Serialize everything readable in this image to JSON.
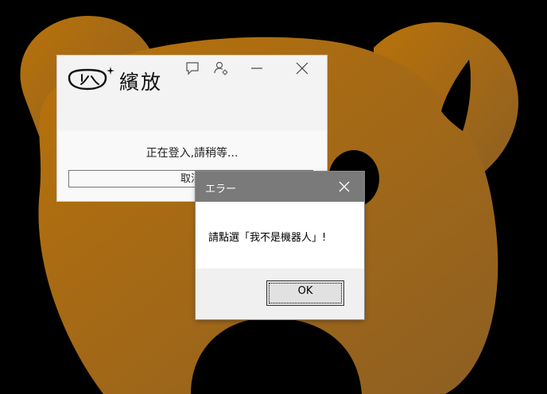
{
  "login_window": {
    "app_name": "繽放",
    "status_text": "正在登入,請稍等...",
    "cancel_label": "取消"
  },
  "error_dialog": {
    "title": "エラー",
    "message": "請點選「我不是機器人」!",
    "ok_label": "OK"
  },
  "icons": {
    "titlebar": [
      "chat-icon",
      "user-settings-icon",
      "minimize-icon",
      "close-icon"
    ],
    "dialog": [
      "close-icon"
    ]
  },
  "colors": {
    "wallpaper_bear": "#b06e0b",
    "wallpaper_background": "#000000",
    "dialog_titlebar": "#7a7a7a"
  }
}
